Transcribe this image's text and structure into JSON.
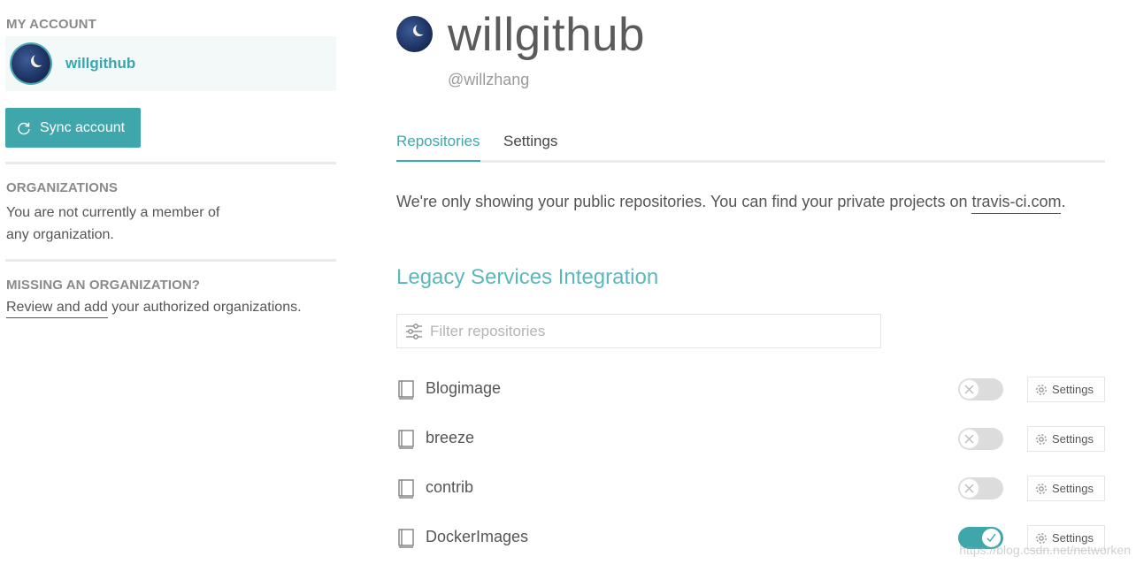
{
  "sidebar": {
    "my_account_title": "MY ACCOUNT",
    "account_name": "willgithub",
    "sync_label": "Sync account",
    "organizations_title": "ORGANIZATIONS",
    "organizations_text": "You are not currently a member of any organization.",
    "missing_title": "MISSING AN ORGANIZATION?",
    "missing_link": "Review and add",
    "missing_text": " your authorized organizations."
  },
  "profile": {
    "name": "willgithub",
    "handle": "@willzhang"
  },
  "tabs": [
    {
      "label": "Repositories",
      "active": true
    },
    {
      "label": "Settings",
      "active": false
    }
  ],
  "notice": {
    "text": "We're only showing your public repositories. You can find your private projects on ",
    "link": "travis-ci.com",
    "suffix": "."
  },
  "legacy": {
    "title": "Legacy Services Integration",
    "filter_placeholder": "Filter repositories"
  },
  "repos": [
    {
      "name": "Blogimage",
      "enabled": false,
      "settings_label": "Settings"
    },
    {
      "name": "breeze",
      "enabled": false,
      "settings_label": "Settings"
    },
    {
      "name": "contrib",
      "enabled": false,
      "settings_label": "Settings"
    },
    {
      "name": "DockerImages",
      "enabled": true,
      "settings_label": "Settings"
    }
  ],
  "watermark": "https://blog.csdn.net/networken",
  "colors": {
    "accent": "#3fa7ac",
    "sidebar_card": "#f3f8f8",
    "toggle_off": "#dcdcdc"
  }
}
